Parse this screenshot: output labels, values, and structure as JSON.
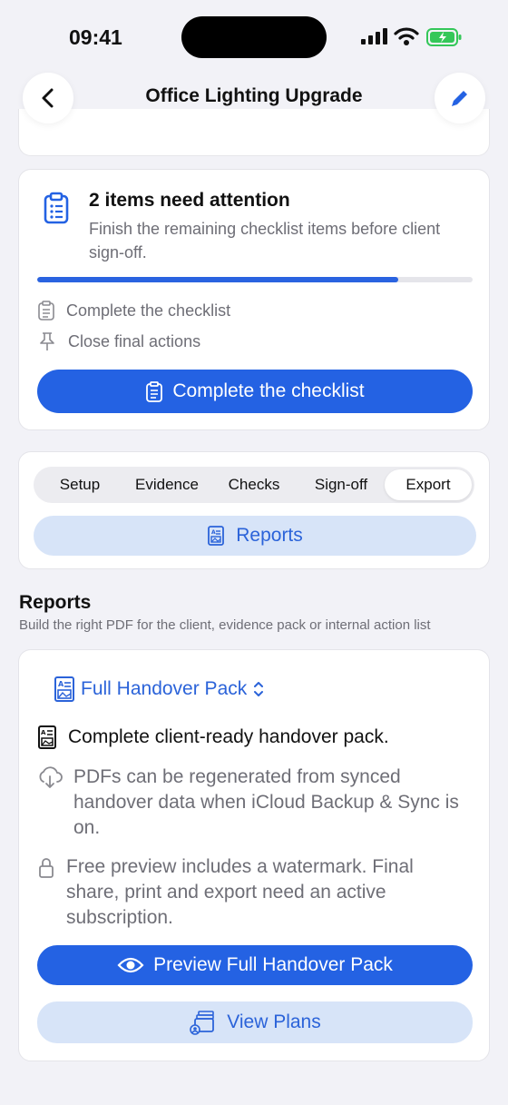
{
  "status": {
    "time": "09:41"
  },
  "nav": {
    "title": "Office Lighting Upgrade"
  },
  "attention": {
    "title": "2 items need attention",
    "description": "Finish the remaining checklist items before client sign-off.",
    "progress": 0.83,
    "rows": [
      {
        "label": "Complete the checklist",
        "icon": "clipboard-icon"
      },
      {
        "label": "Close final actions",
        "icon": "pin-icon"
      }
    ],
    "button_label": "Complete the checklist"
  },
  "tabs": {
    "items": [
      "Setup",
      "Evidence",
      "Checks",
      "Sign-off",
      "Export"
    ],
    "active": "Export",
    "section_button": "Reports"
  },
  "reports": {
    "title": "Reports",
    "subtitle": "Build the right PDF for the client, evidence pack or internal action list",
    "selected_report": "Full Handover Pack",
    "description": "Complete client-ready handover pack.",
    "sync_note": "PDFs can be regenerated from synced handover data when iCloud Backup & Sync is on.",
    "watermark_note": "Free preview includes a watermark. Final share, print and export need an active subscription.",
    "preview_label": "Preview Full Handover Pack",
    "plans_label": "View Plans"
  },
  "colors": {
    "accent": "#2462e3",
    "accent_light": "#d7e4f8",
    "battery": "#34c759"
  }
}
